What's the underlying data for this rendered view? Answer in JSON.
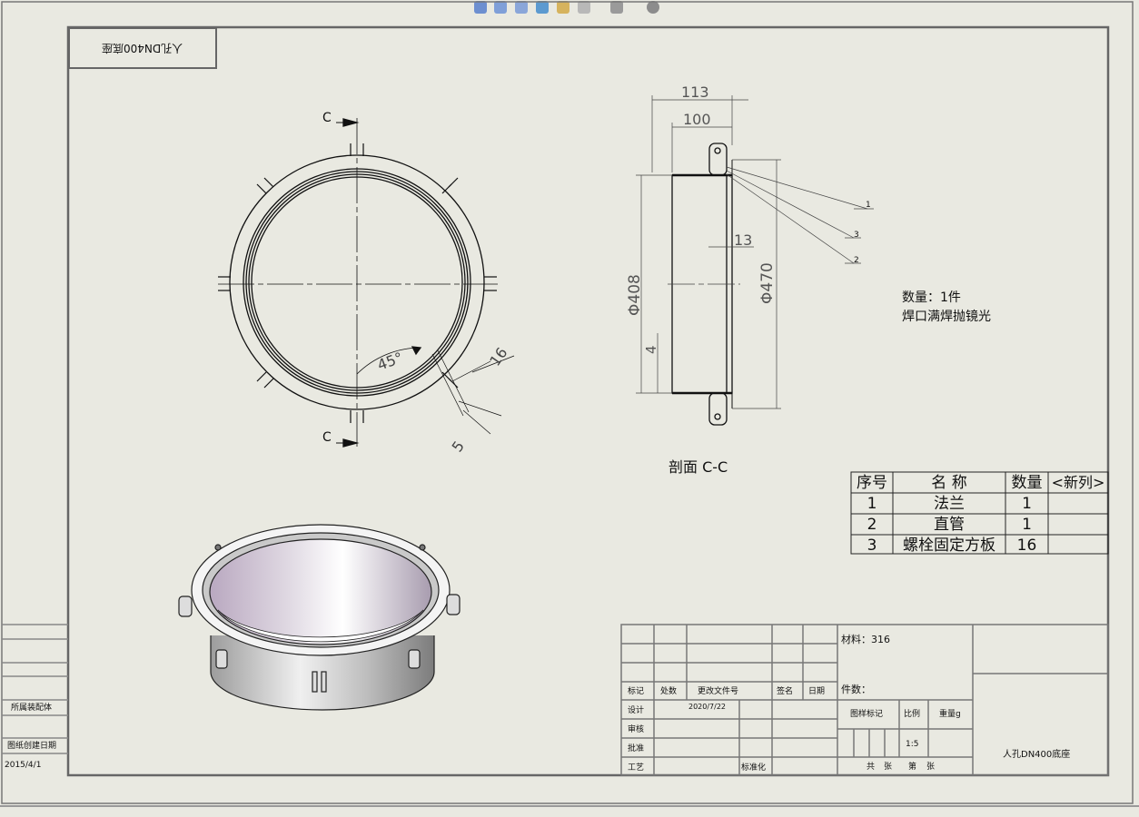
{
  "toolbar": {
    "icons": [
      "zoom-to-fit-icon",
      "zoom-area-icon",
      "pan-icon",
      "rotate-icon",
      "display-style-icon",
      "section-view-icon",
      "hide-show-icon",
      "appearance-icon"
    ]
  },
  "drawing": {
    "mirrored_label": "人孔DN400底座",
    "front_view": {
      "section_letter_top": "C",
      "section_letter_bottom": "C",
      "angle_dim": "45°",
      "dim_16": "16",
      "dim_5": "5"
    },
    "section_view": {
      "dim_113": "113",
      "dim_100": "100",
      "dim_13": "13",
      "dim_408": "Φ408",
      "dim_470": "Φ470",
      "dim_4": "4",
      "balloon_1": "1",
      "balloon_3": "3",
      "balloon_2": "2",
      "caption": "剖面 C-C"
    },
    "notes": {
      "line1": "数量：1件",
      "line2": "焊口满焊抛镜光"
    }
  },
  "bom": {
    "headers": [
      "序号",
      "名 称",
      "数量",
      "<新列>"
    ],
    "rows": [
      {
        "no": "1",
        "name": "法兰",
        "qty": "1",
        "extra": ""
      },
      {
        "no": "2",
        "name": "直管",
        "qty": "1",
        "extra": ""
      },
      {
        "no": "3",
        "name": "螺栓固定方板",
        "qty": "16",
        "extra": ""
      }
    ]
  },
  "title_block": {
    "material": "材料：316",
    "part_count": "件数：",
    "mark": "标记",
    "count": "处数",
    "change_doc": "更改文件号",
    "signature": "签名",
    "date": "日期",
    "design": "设计",
    "design_date": "2020/7/22",
    "review": "审核",
    "approve": "批准",
    "process": "工艺",
    "standardize": "标准化",
    "drawing_mark": "图样标记",
    "scale_label": "比例",
    "weight_label": "重量g",
    "scale_value": "1:5",
    "total": "共",
    "sheets": "张",
    "sheet_no": "第",
    "sheet_no2": "张",
    "drawing_name": "人孔DN400底座"
  },
  "left_block": {
    "assembly": "所属装配体",
    "created_label": "图纸创建日期",
    "created_value": "2015/4/1"
  }
}
